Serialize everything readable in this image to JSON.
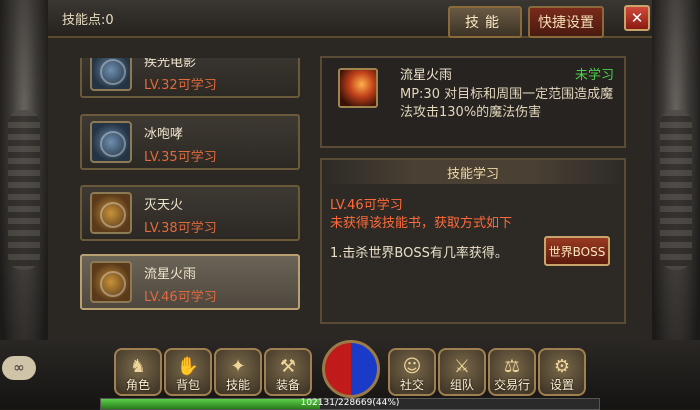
{
  "header": {
    "skill_points": "技能点:0",
    "tab_skill": "技能",
    "tab_quick": "快捷设置",
    "close_label": "✕"
  },
  "skills": [
    {
      "name": "疾光电影",
      "level": "LV.32可学习",
      "icon": "lightning-skill-icon"
    },
    {
      "name": "冰咆哮",
      "level": "LV.35可学习",
      "icon": "ice-skill-icon"
    },
    {
      "name": "灭天火",
      "level": "LV.38可学习",
      "icon": "fire-skill-icon"
    },
    {
      "name": "流星火雨",
      "level": "LV.46可学习",
      "icon": "meteor-skill-icon"
    }
  ],
  "detail": {
    "name": "流星火雨",
    "status": "未学习",
    "description": "MP:30 对目标和周围一定范围造成魔法攻击130%的魔法伤害"
  },
  "learn": {
    "title": "技能学习",
    "level_req": "LV.46可学习",
    "note": "未获得该技能书，获取方式如下",
    "method": "1.击杀世界BOSS有几率获得。",
    "button": "世界BOSS"
  },
  "menu": [
    {
      "label": "角色",
      "icon": "character-icon"
    },
    {
      "label": "背包",
      "icon": "bag-icon"
    },
    {
      "label": "技能",
      "icon": "skill-icon"
    },
    {
      "label": "装备",
      "icon": "equipment-icon"
    },
    {
      "label": "社交",
      "icon": "social-icon"
    },
    {
      "label": "组队",
      "icon": "team-icon"
    },
    {
      "label": "交易行",
      "icon": "trade-icon"
    },
    {
      "label": "设置",
      "icon": "settings-icon"
    }
  ],
  "chat": "∞",
  "xp": {
    "text": "102131/228669(44%)",
    "fraction": 0.44
  },
  "colors": {
    "learnable": "#e06a3c",
    "unlearned": "#4fcf4a",
    "hp": "#c01a1a",
    "mp": "#1a3ac8"
  }
}
